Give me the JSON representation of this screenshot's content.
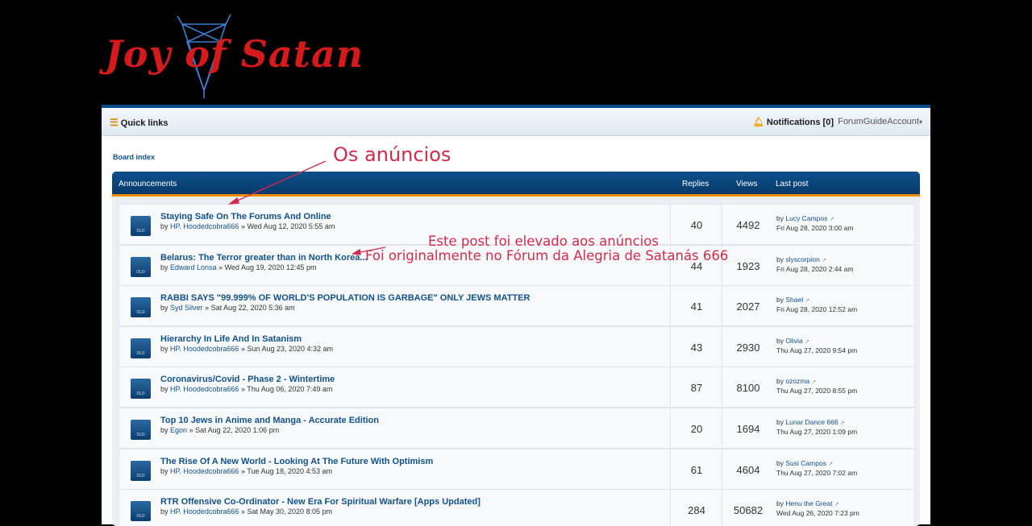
{
  "logo": {
    "text": "Joy of Satan",
    "color": "#d41a1a",
    "pentagram_color": "#3a7fd6"
  },
  "navbar": {
    "quick_links_icon": "bars-icon",
    "quick_links": "Quick links",
    "notifications_icon": "bell-icon",
    "notifications": "Notifications [0]",
    "account": "ForumGuideAccount",
    "account_caret": "▾"
  },
  "breadcrumb": "Board index",
  "forum": {
    "header": {
      "title": "Announcements",
      "replies": "Replies",
      "views": "Views",
      "last_post": "Last post"
    },
    "topics": [
      {
        "title": "Staying Safe On The Forums And Online",
        "by": "by",
        "author": "HP. Hoodedcobra666",
        "date": "» Wed Aug 12, 2020 5:55 am",
        "replies": "40",
        "views": "4492",
        "last_by": "by",
        "last_author": "Lucy Campos",
        "last_date": "Fri Aug 28, 2020 3:00 am"
      },
      {
        "title": "Belarus: The Terror greater than in North Korea...",
        "by": "by",
        "author": "Edward Lonsa",
        "date": "» Wed Aug 19, 2020 12:45 pm",
        "replies": "44",
        "views": "1923",
        "last_by": "by",
        "last_author": "slyscorpion",
        "last_date": "Fri Aug 28, 2020 2:44 am"
      },
      {
        "title": "RABBI SAYS \"99.999% OF WORLD'S POPULATION IS GARBAGE\" ONLY JEWS MATTER",
        "by": "by",
        "author": "Syd Silver",
        "date": "» Sat Aug 22, 2020 5:36 am",
        "replies": "41",
        "views": "2027",
        "last_by": "by",
        "last_author": "Shael",
        "last_date": "Fri Aug 28, 2020 12:52 am"
      },
      {
        "title": "Hierarchy In Life And In Satanism",
        "by": "by",
        "author": "HP. Hoodedcobra666",
        "date": "» Sun Aug 23, 2020 4:32 am",
        "replies": "43",
        "views": "2930",
        "last_by": "by",
        "last_author": "Olivia",
        "last_date": "Thu Aug 27, 2020 9:54 pm"
      },
      {
        "title": "Coronavirus/Covid - Phase 2 - Wintertime",
        "by": "by",
        "author": "HP. Hoodedcobra666",
        "date": "» Thu Aug 06, 2020 7:49 am",
        "replies": "87",
        "views": "8100",
        "last_by": "by",
        "last_author": "ozozma",
        "last_date": "Thu Aug 27, 2020 8:55 pm"
      },
      {
        "title": "Top 10 Jews in Anime and Manga - Accurate Edition",
        "by": "by",
        "author": "Egon",
        "date": "» Sat Aug 22, 2020 1:06 pm",
        "replies": "20",
        "views": "1694",
        "last_by": "by",
        "last_author": "Lunar Dance 666",
        "last_date": "Thu Aug 27, 2020 1:09 pm"
      },
      {
        "title": "The Rise Of A New World - Looking At The Future With Optimism",
        "by": "by",
        "author": "HP. Hoodedcobra666",
        "date": "» Tue Aug 18, 2020 4:53 am",
        "replies": "61",
        "views": "4604",
        "last_by": "by",
        "last_author": "Susi Campos",
        "last_date": "Thu Aug 27, 2020 7:02 am"
      },
      {
        "title": "RTR Offensive Co-Ordinator - New Era For Spiritual Warfare [Apps Updated]",
        "by": "by",
        "author": "HP. Hoodedcobra666",
        "date": "» Sat May 30, 2020 8:05 pm",
        "replies": "284",
        "views": "50682",
        "last_by": "by",
        "last_author": "Henu the Great",
        "last_date": "Wed Aug 26, 2020 7:23 pm"
      }
    ],
    "icon_label": "OLD",
    "last_post_icon": "view-latest-post-icon"
  },
  "annotations": {
    "announcements": "Os anúncios",
    "elevated_line1": "Este post foi elevado aos anúncios",
    "elevated_line2": "Foi originalmente no Fórum da Alegria de Satanás 666",
    "color": "#d62a4a"
  }
}
